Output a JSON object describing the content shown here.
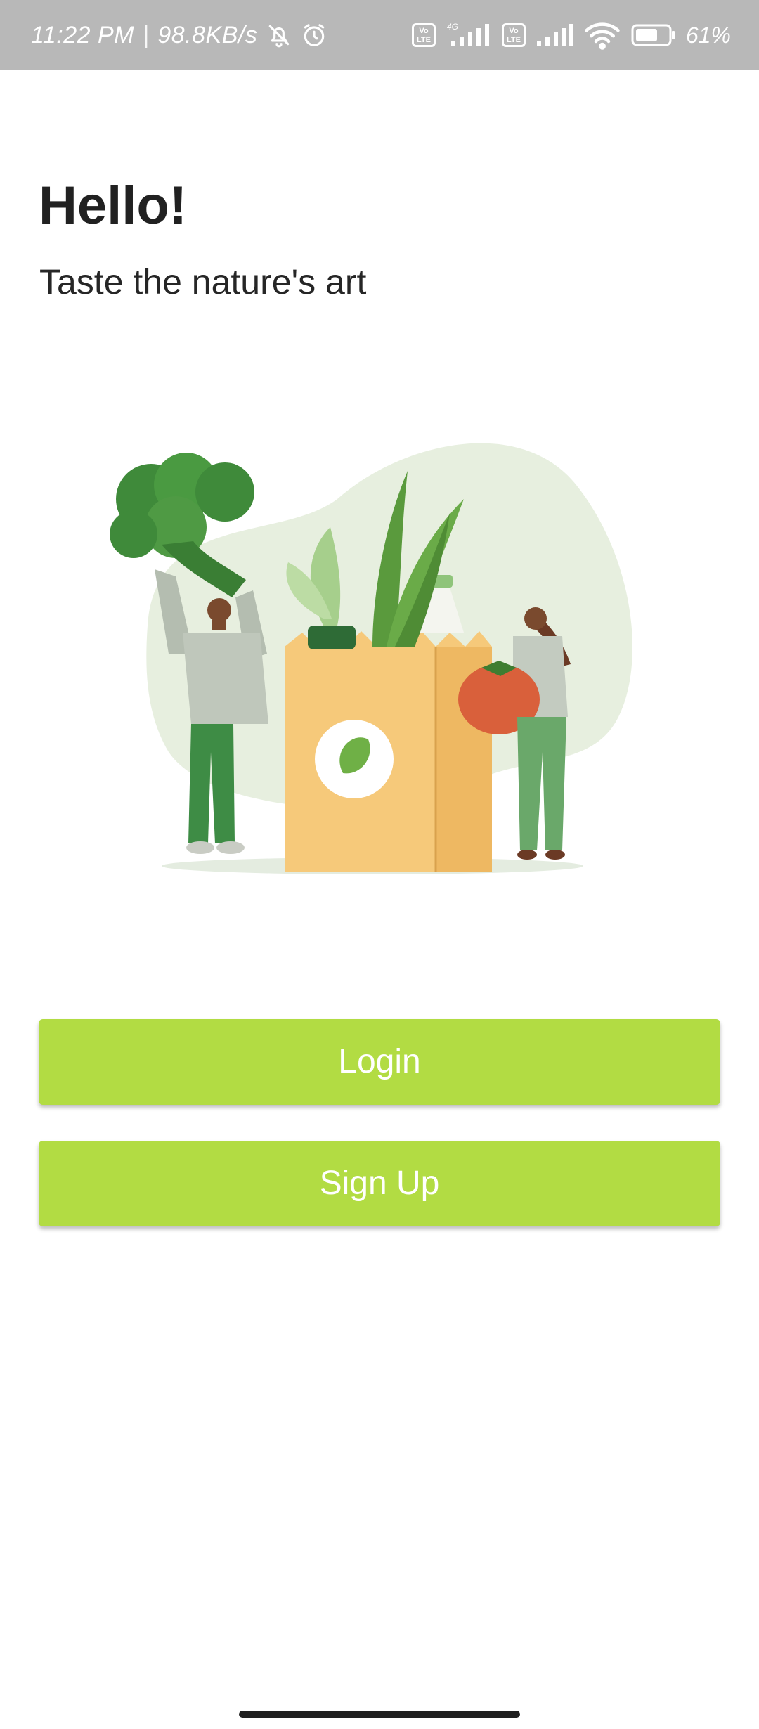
{
  "status_bar": {
    "time": "11:22 PM",
    "separator": "|",
    "network_speed": "98.8KB/s",
    "icons_left": [
      "bell-off-icon",
      "alarm-icon"
    ],
    "volte_label": "Vo LTE",
    "network_type": "4G",
    "battery": "61%"
  },
  "welcome": {
    "greeting": "Hello!",
    "tagline": "Taste the nature's art"
  },
  "actions": {
    "login_label": "Login",
    "signup_label": "Sign Up"
  },
  "colors": {
    "accent": "#b2dc43",
    "status_bar_bg": "#b8b8b8",
    "text_primary": "#212121"
  }
}
